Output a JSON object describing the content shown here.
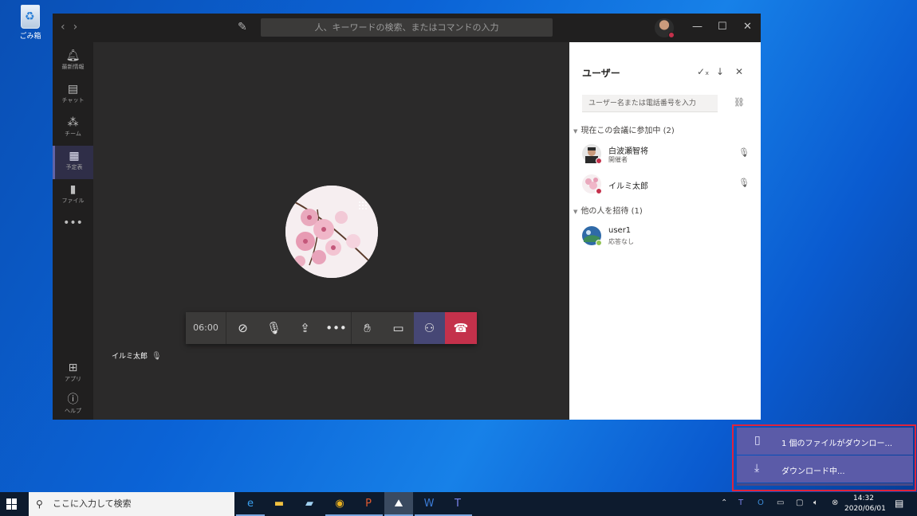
{
  "desktop": {
    "recycle_bin_label": "ごみ箱"
  },
  "window": {
    "search_placeholder": "人、キーワードの検索、またはコマンドの入力",
    "rail": [
      {
        "label": "最新情報",
        "icon": "bell-icon",
        "glyph": "🔔"
      },
      {
        "label": "チャット",
        "icon": "chat-icon",
        "glyph": "💬"
      },
      {
        "label": "チーム",
        "icon": "teams-icon",
        "glyph": "👥"
      },
      {
        "label": "予定表",
        "icon": "calendar-icon",
        "glyph": "📅"
      },
      {
        "label": "ファイル",
        "icon": "file-icon",
        "glyph": "📄"
      },
      {
        "label": "",
        "icon": "more-icon",
        "glyph": "•••"
      },
      {
        "label": "アプリ",
        "icon": "apps-icon",
        "glyph": "⊞"
      },
      {
        "label": "ヘルプ",
        "icon": "help-icon",
        "glyph": "?"
      }
    ]
  },
  "call": {
    "timer": "06:00",
    "participant_name": "イルミ太郎"
  },
  "roster": {
    "title": "ユーザー",
    "invite_placeholder": "ユーザー名または電話番号を入力",
    "in_meeting_header": "現在この会議に参加中 (2)",
    "invited_header": "他の人を招待 (1)",
    "in_meeting": [
      {
        "name": "白波瀬智将",
        "role": "開催者",
        "status_color": "#c4314b"
      },
      {
        "name": "イルミ太郎",
        "role": "",
        "status_color": "#c4314b"
      }
    ],
    "invited": [
      {
        "name": "user1",
        "role": "応答なし",
        "status_color": "#92c353"
      }
    ]
  },
  "downloads": {
    "item1": "1 個のファイルがダウンロー...",
    "item2": "ダウンロード中..."
  },
  "taskbar": {
    "search_placeholder": "ここに入力して検索",
    "time": "14:32",
    "date": "2020/06/01"
  },
  "colors": {
    "teams_accent": "#6264a7",
    "hangup": "#c4314b",
    "highlight_border": "#e0243c"
  }
}
